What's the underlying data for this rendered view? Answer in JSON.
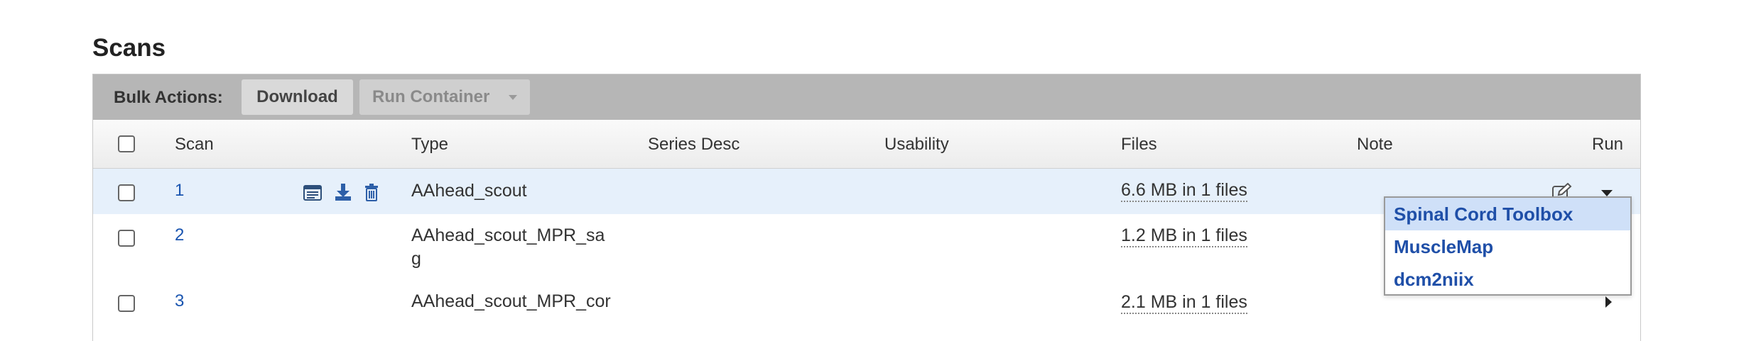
{
  "page": {
    "title": "Scans"
  },
  "bulk_actions": {
    "label": "Bulk Actions:",
    "download_label": "Download",
    "run_container_label": "Run Container"
  },
  "table": {
    "columns": [
      "Scan",
      "Type",
      "Series Desc",
      "Usability",
      "Files",
      "Note",
      "Run"
    ],
    "rows": [
      {
        "id": "1",
        "type": "AAhead_scout",
        "series_desc": "",
        "usability": "",
        "files": "6.6 MB in 1 files",
        "note": ""
      },
      {
        "id": "2",
        "type": "AAhead_scout_MPR_sag",
        "series_desc": "",
        "usability": "",
        "files": "1.2 MB in 1 files",
        "note": ""
      },
      {
        "id": "3",
        "type": "AAhead_scout_MPR_cor",
        "series_desc": "",
        "usability": "",
        "files": "2.1 MB in 1 files",
        "note": ""
      }
    ]
  },
  "run_dropdown": {
    "items": [
      "Spinal Cord Toolbox",
      "MuscleMap",
      "dcm2niix"
    ],
    "highlighted_index": 0
  },
  "colors": {
    "accent": "#1a55b0",
    "selected_row": "#e6f0fb",
    "bulk_bar": "#b6b6b6",
    "icon_blue": "#2d5fa8"
  },
  "icons": {
    "row_actions": [
      "details-icon",
      "download-icon",
      "trash-icon"
    ],
    "note": "edit-note-icon"
  }
}
